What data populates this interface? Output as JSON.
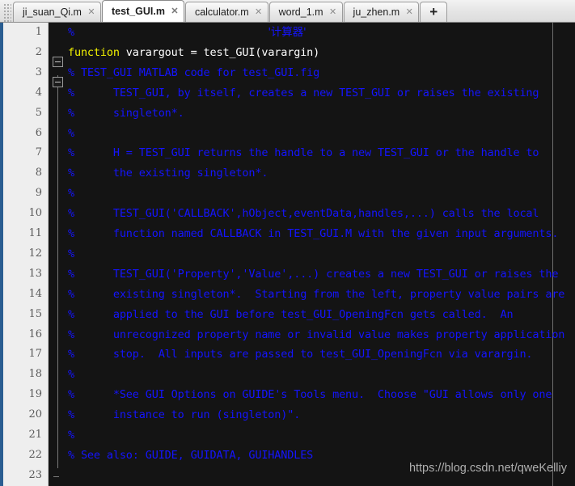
{
  "window": {
    "title": "test_GUI.m",
    "app": "MATLAB Editor"
  },
  "tabbar": {
    "grip_name": "tab-drag-grip",
    "close_glyph": "✕",
    "new_tab_label": "+",
    "tabs": [
      {
        "label": "ji_suan_Qi.m",
        "active": false
      },
      {
        "label": "test_GUI.m",
        "active": true
      },
      {
        "label": "calculator.m",
        "active": false
      },
      {
        "label": "word_1.m",
        "active": false
      },
      {
        "label": "ju_zhen.m",
        "active": false
      }
    ]
  },
  "editor": {
    "language": "MATLAB",
    "first_line": 1,
    "last_line": 23,
    "line_numbers": [
      1,
      2,
      3,
      4,
      5,
      6,
      7,
      8,
      9,
      10,
      11,
      12,
      13,
      14,
      15,
      16,
      17,
      18,
      19,
      20,
      21,
      22,
      23
    ],
    "colors": {
      "background": "#141414",
      "gutter": "#eeeeee",
      "comment": "#1414ff",
      "keyword": "#f2f200",
      "plain": "#ffffff",
      "accent": "#2a5d91"
    },
    "lines": [
      {
        "n": 1,
        "text": "%                                  '计算器'"
      },
      {
        "n": 2,
        "text": "function varargout = test_GUI(varargin)"
      },
      {
        "n": 3,
        "text": "% TEST_GUI MATLAB code for test_GUI.fig"
      },
      {
        "n": 4,
        "text": "%      TEST_GUI, by itself, creates a new TEST_GUI or raises the existing"
      },
      {
        "n": 5,
        "text": "%      singleton*."
      },
      {
        "n": 6,
        "text": "%"
      },
      {
        "n": 7,
        "text": "%      H = TEST_GUI returns the handle to a new TEST_GUI or the handle to"
      },
      {
        "n": 8,
        "text": "%      the existing singleton*."
      },
      {
        "n": 9,
        "text": "%"
      },
      {
        "n": 10,
        "text": "%      TEST_GUI('CALLBACK',hObject,eventData,handles,...) calls the local"
      },
      {
        "n": 11,
        "text": "%      function named CALLBACK in TEST_GUI.M with the given input arguments."
      },
      {
        "n": 12,
        "text": "%"
      },
      {
        "n": 13,
        "text": "%      TEST_GUI('Property','Value',...) creates a new TEST_GUI or raises the"
      },
      {
        "n": 14,
        "text": "%      existing singleton*.  Starting from the left, property value pairs are"
      },
      {
        "n": 15,
        "text": "%      applied to the GUI before test_GUI_OpeningFcn gets called.  An"
      },
      {
        "n": 16,
        "text": "%      unrecognized property name or invalid value makes property application"
      },
      {
        "n": 17,
        "text": "%      stop.  All inputs are passed to test_GUI_OpeningFcn via varargin."
      },
      {
        "n": 18,
        "text": "%"
      },
      {
        "n": 19,
        "text": "%      *See GUI Options on GUIDE's Tools menu.  Choose \"GUI allows only one"
      },
      {
        "n": 20,
        "text": "%      instance to run (singleton)\"."
      },
      {
        "n": 21,
        "text": "%"
      },
      {
        "n": 22,
        "text": "% See also: GUIDE, GUIDATA, GUIHANDLES"
      },
      {
        "n": 23,
        "text": ""
      }
    ],
    "line1": {
      "comment_mark": "%",
      "chinese_literal": "'计算器'"
    },
    "line2": {
      "keyword": "function",
      "rest": " varargout = test_GUI(varargin)"
    },
    "folds": [
      {
        "line": 2,
        "type": "collapse-box"
      },
      {
        "line": 3,
        "type": "collapse-box"
      },
      {
        "line": 22,
        "type": "fold-end"
      }
    ]
  },
  "watermark": {
    "text": "https://blog.csdn.net/qweKelliy"
  }
}
